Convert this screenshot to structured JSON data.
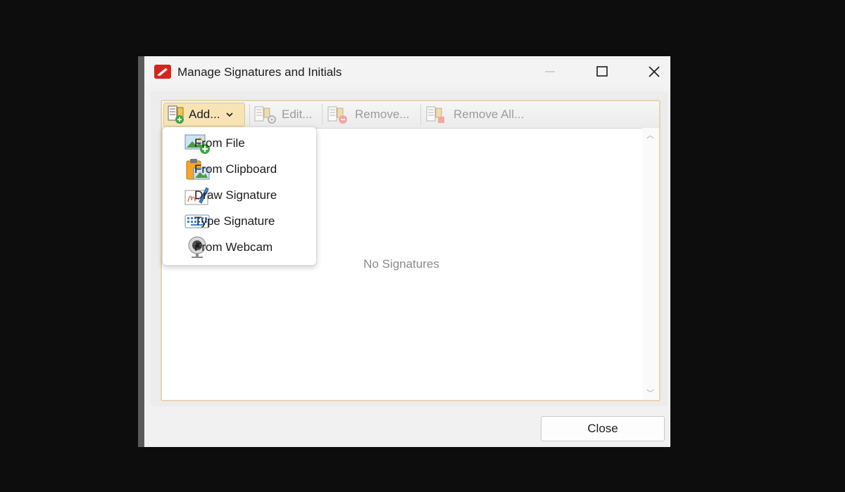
{
  "window": {
    "title": "Manage Signatures and Initials"
  },
  "toolbar": {
    "add_label": "Add...",
    "edit_label": "Edit...",
    "remove_label": "Remove...",
    "remove_all_label": "Remove All..."
  },
  "list": {
    "empty_text": "No Signatures"
  },
  "add_menu": {
    "items": [
      {
        "label": "From File",
        "icon": "image-add-icon"
      },
      {
        "label": "From Clipboard",
        "icon": "clipboard-image-icon"
      },
      {
        "label": "Draw Signature",
        "icon": "pen-signature-icon"
      },
      {
        "label": "Type Signature",
        "icon": "keyboard-icon"
      },
      {
        "label": "From Webcam",
        "icon": "webcam-icon"
      }
    ]
  },
  "footer": {
    "close_label": "Close"
  },
  "colors": {
    "accent_highlight": "#f7e3b4",
    "panel_border": "#e6d4b3",
    "app_icon_red": "#d2261f"
  }
}
